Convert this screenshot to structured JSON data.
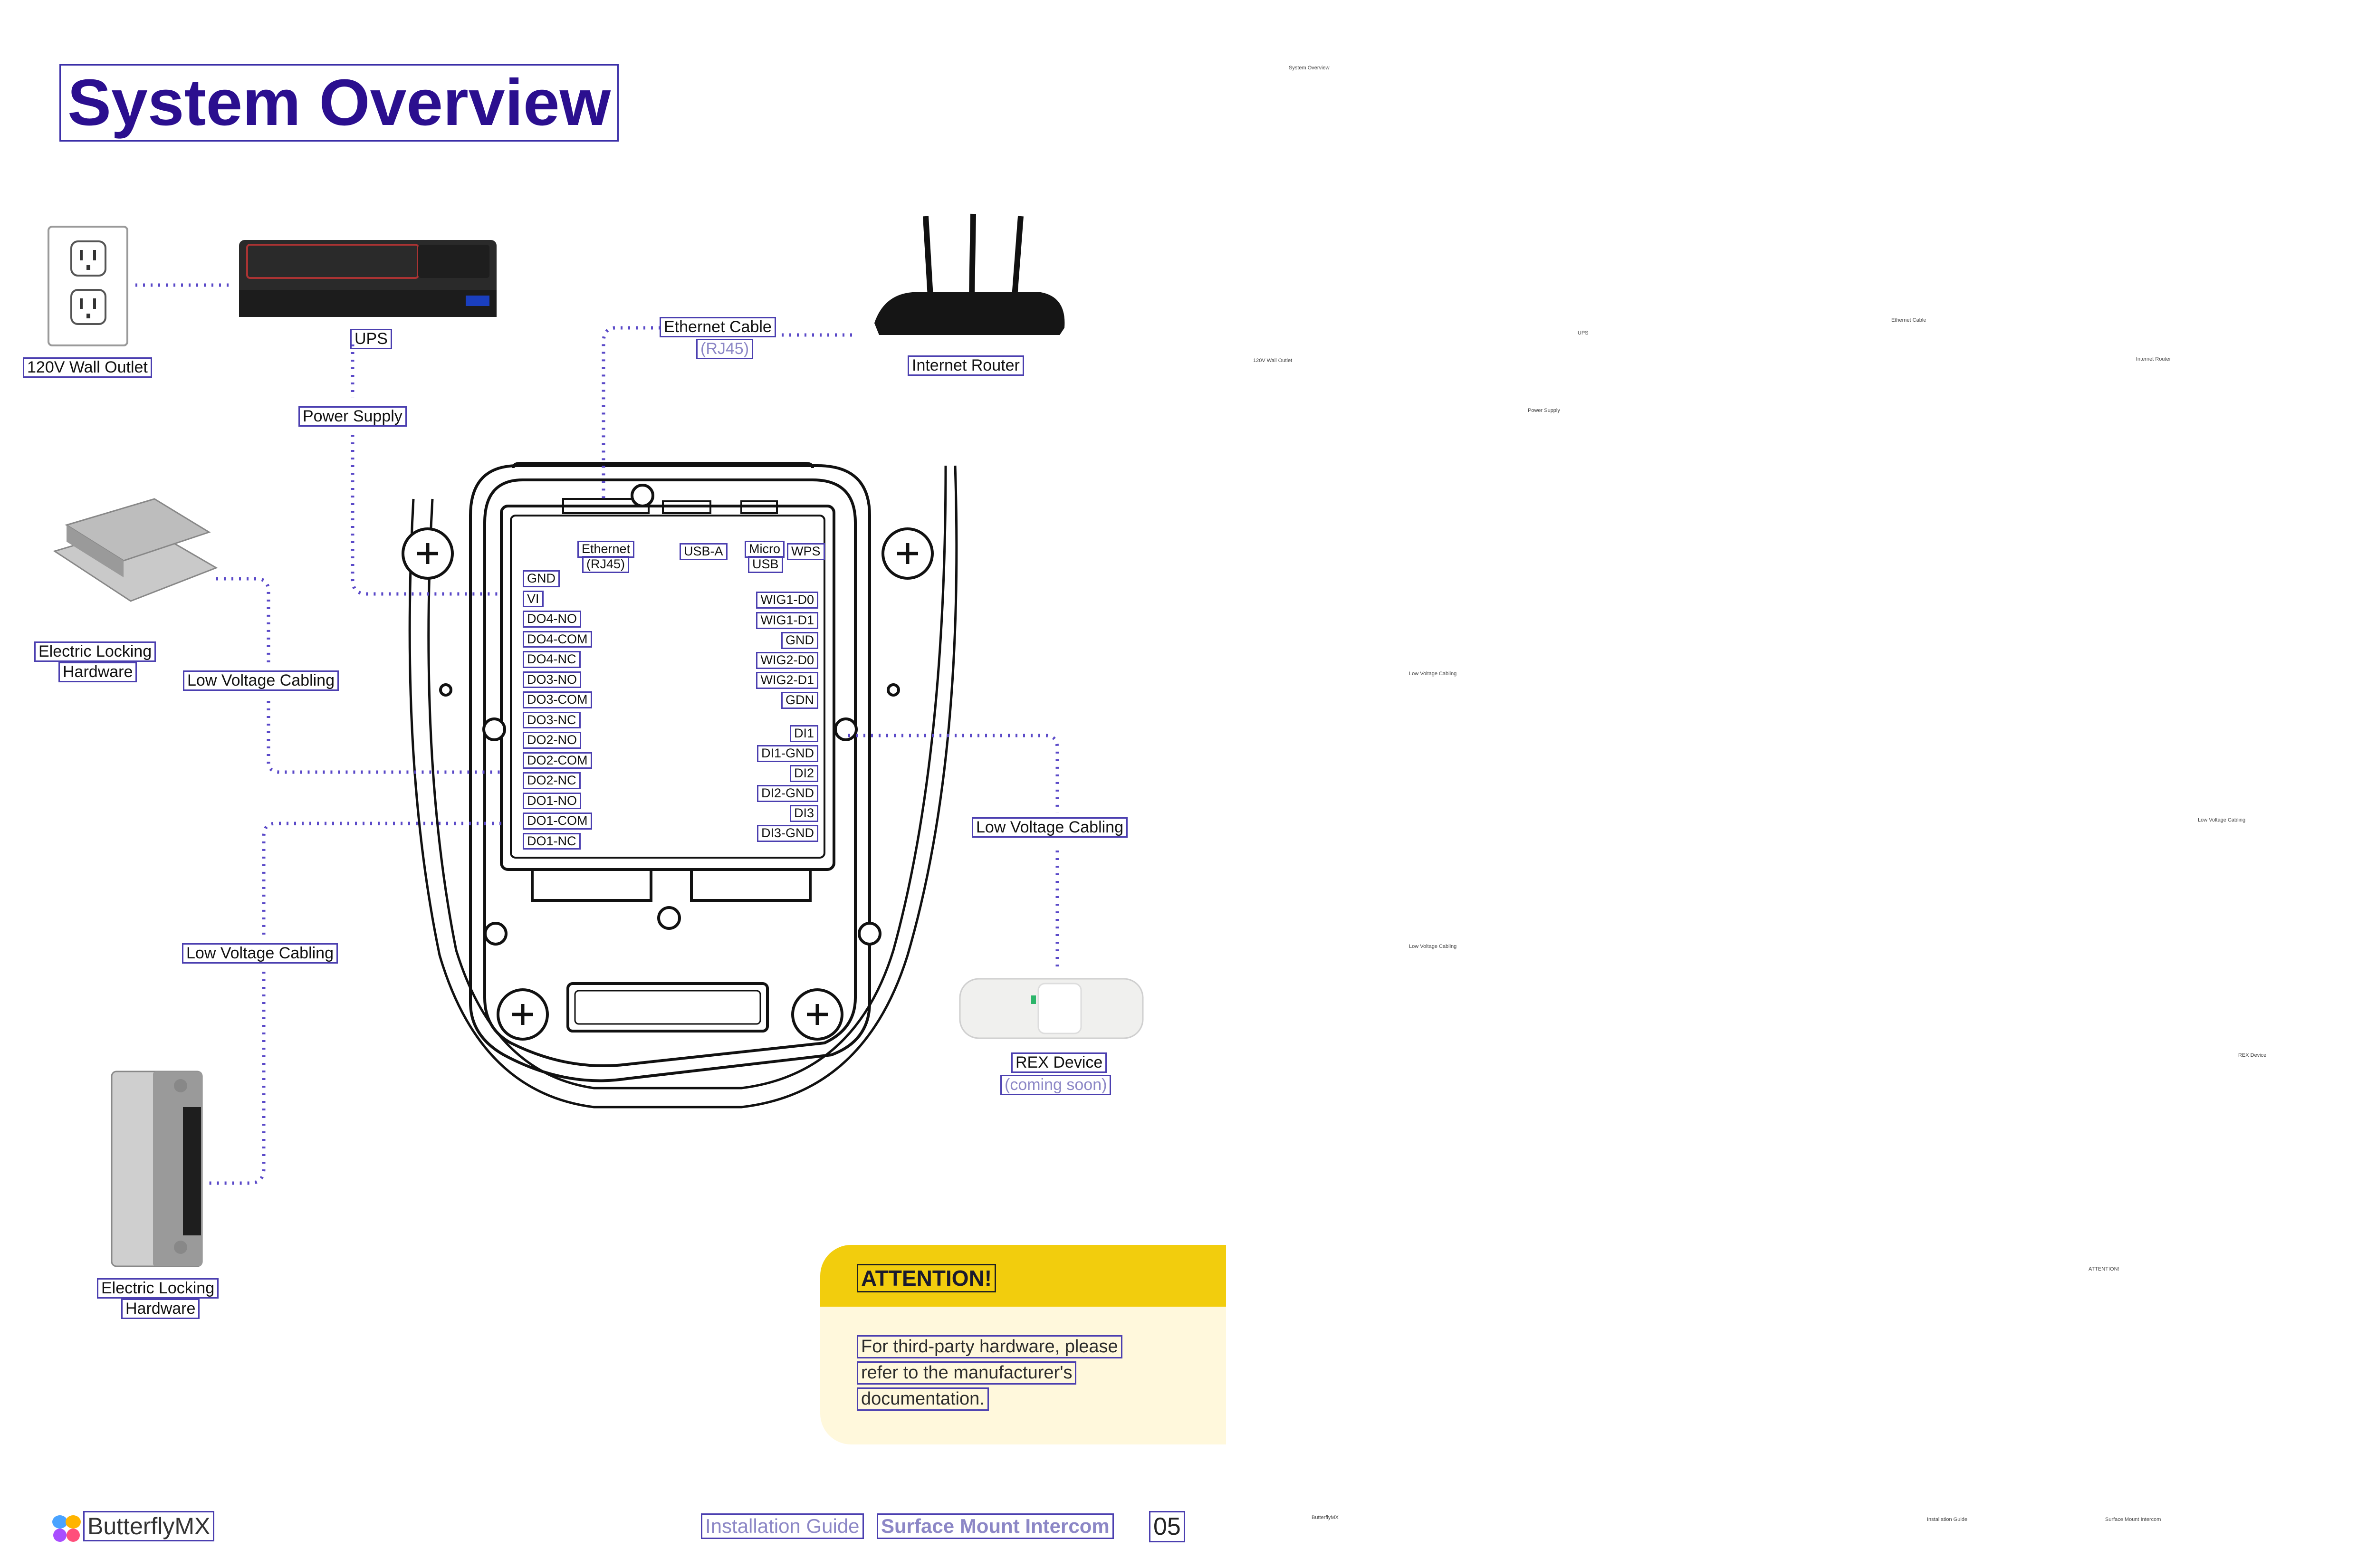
{
  "title": "System Overview",
  "components": {
    "wall_outlet": "120V Wall Outlet",
    "ups": "UPS",
    "power_supply": "Power Supply",
    "ethernet_cable": "Ethernet Cable",
    "ethernet_cable_sub": "(RJ45)",
    "internet_router": "Internet Router",
    "locking_hw_top": [
      "Electric Locking",
      "Hardware"
    ],
    "locking_hw_bottom": [
      "Electric Locking",
      "Hardware"
    ],
    "low_voltage_1": "Low Voltage Cabling",
    "low_voltage_2": "Low Voltage Cabling",
    "low_voltage_3": "Low Voltage Cabling",
    "rex_device": "REX Device",
    "rex_device_sub": "(coming soon)"
  },
  "ports": {
    "ethernet": [
      "Ethernet",
      "(RJ45)"
    ],
    "usb_a": "USB-A",
    "micro_usb": [
      "Micro",
      "USB"
    ],
    "wps": "WPS"
  },
  "pins_left": [
    "GND",
    "VI",
    "DO4-NO",
    "DO4-COM",
    "DO4-NC",
    "DO3-NO",
    "DO3-COM",
    "DO3-NC",
    "DO2-NO",
    "DO2-COM",
    "DO2-NC",
    "DO1-NO",
    "DO1-COM",
    "DO1-NC"
  ],
  "pins_right": [
    "WIG1-D0",
    "WIG1-D1",
    "GND",
    "WIG2-D0",
    "WIG2-D1",
    "GDN",
    "DI1",
    "DI1-GND",
    "DI2",
    "DI2-GND",
    "DI3",
    "DI3-GND"
  ],
  "attention": {
    "title": "ATTENTION!",
    "lines": [
      "For third-party hardware, please",
      "refer to the manufacturer's",
      "documentation."
    ]
  },
  "footer": {
    "brand": "ButterflyMX",
    "guide": "Installation Guide",
    "product": "Surface Mount Intercom",
    "page": "05"
  },
  "colors": {
    "title": "#2b0f8f",
    "annotation_box": "#4b3fb0",
    "connector_dots": "#5a49c8",
    "attention_header": "#f2cd0d",
    "attention_body": "#fff8dc"
  }
}
